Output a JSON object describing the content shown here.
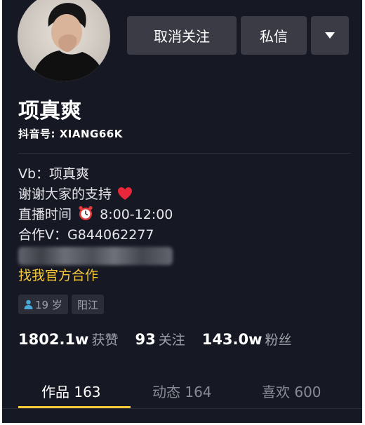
{
  "profile": {
    "name": "项真爽",
    "id_label": "抖音号:",
    "id_value": "XIANG66K"
  },
  "actions": {
    "unfollow": "取消关注",
    "message": "私信"
  },
  "bio": {
    "line1": "Vb：项真爽",
    "line2_text": "谢谢大家的支持",
    "line3_text": "直播时间",
    "line3_time": "8:00-12:00",
    "line4": "合作V：G844062277",
    "link": "找我官方合作"
  },
  "tags": {
    "age": "19 岁",
    "location": "阳江"
  },
  "stats": [
    {
      "value": "1802.1w",
      "label": "获赞"
    },
    {
      "value": "93",
      "label": "关注"
    },
    {
      "value": "143.0w",
      "label": "粉丝"
    }
  ],
  "tabs": [
    {
      "label": "作品 163",
      "active": true
    },
    {
      "label": "动态 164",
      "active": false
    },
    {
      "label": "喜欢 600",
      "active": false
    }
  ],
  "colors": {
    "background": "#161823",
    "accent": "#f5c93a",
    "button": "#3a3b45"
  }
}
